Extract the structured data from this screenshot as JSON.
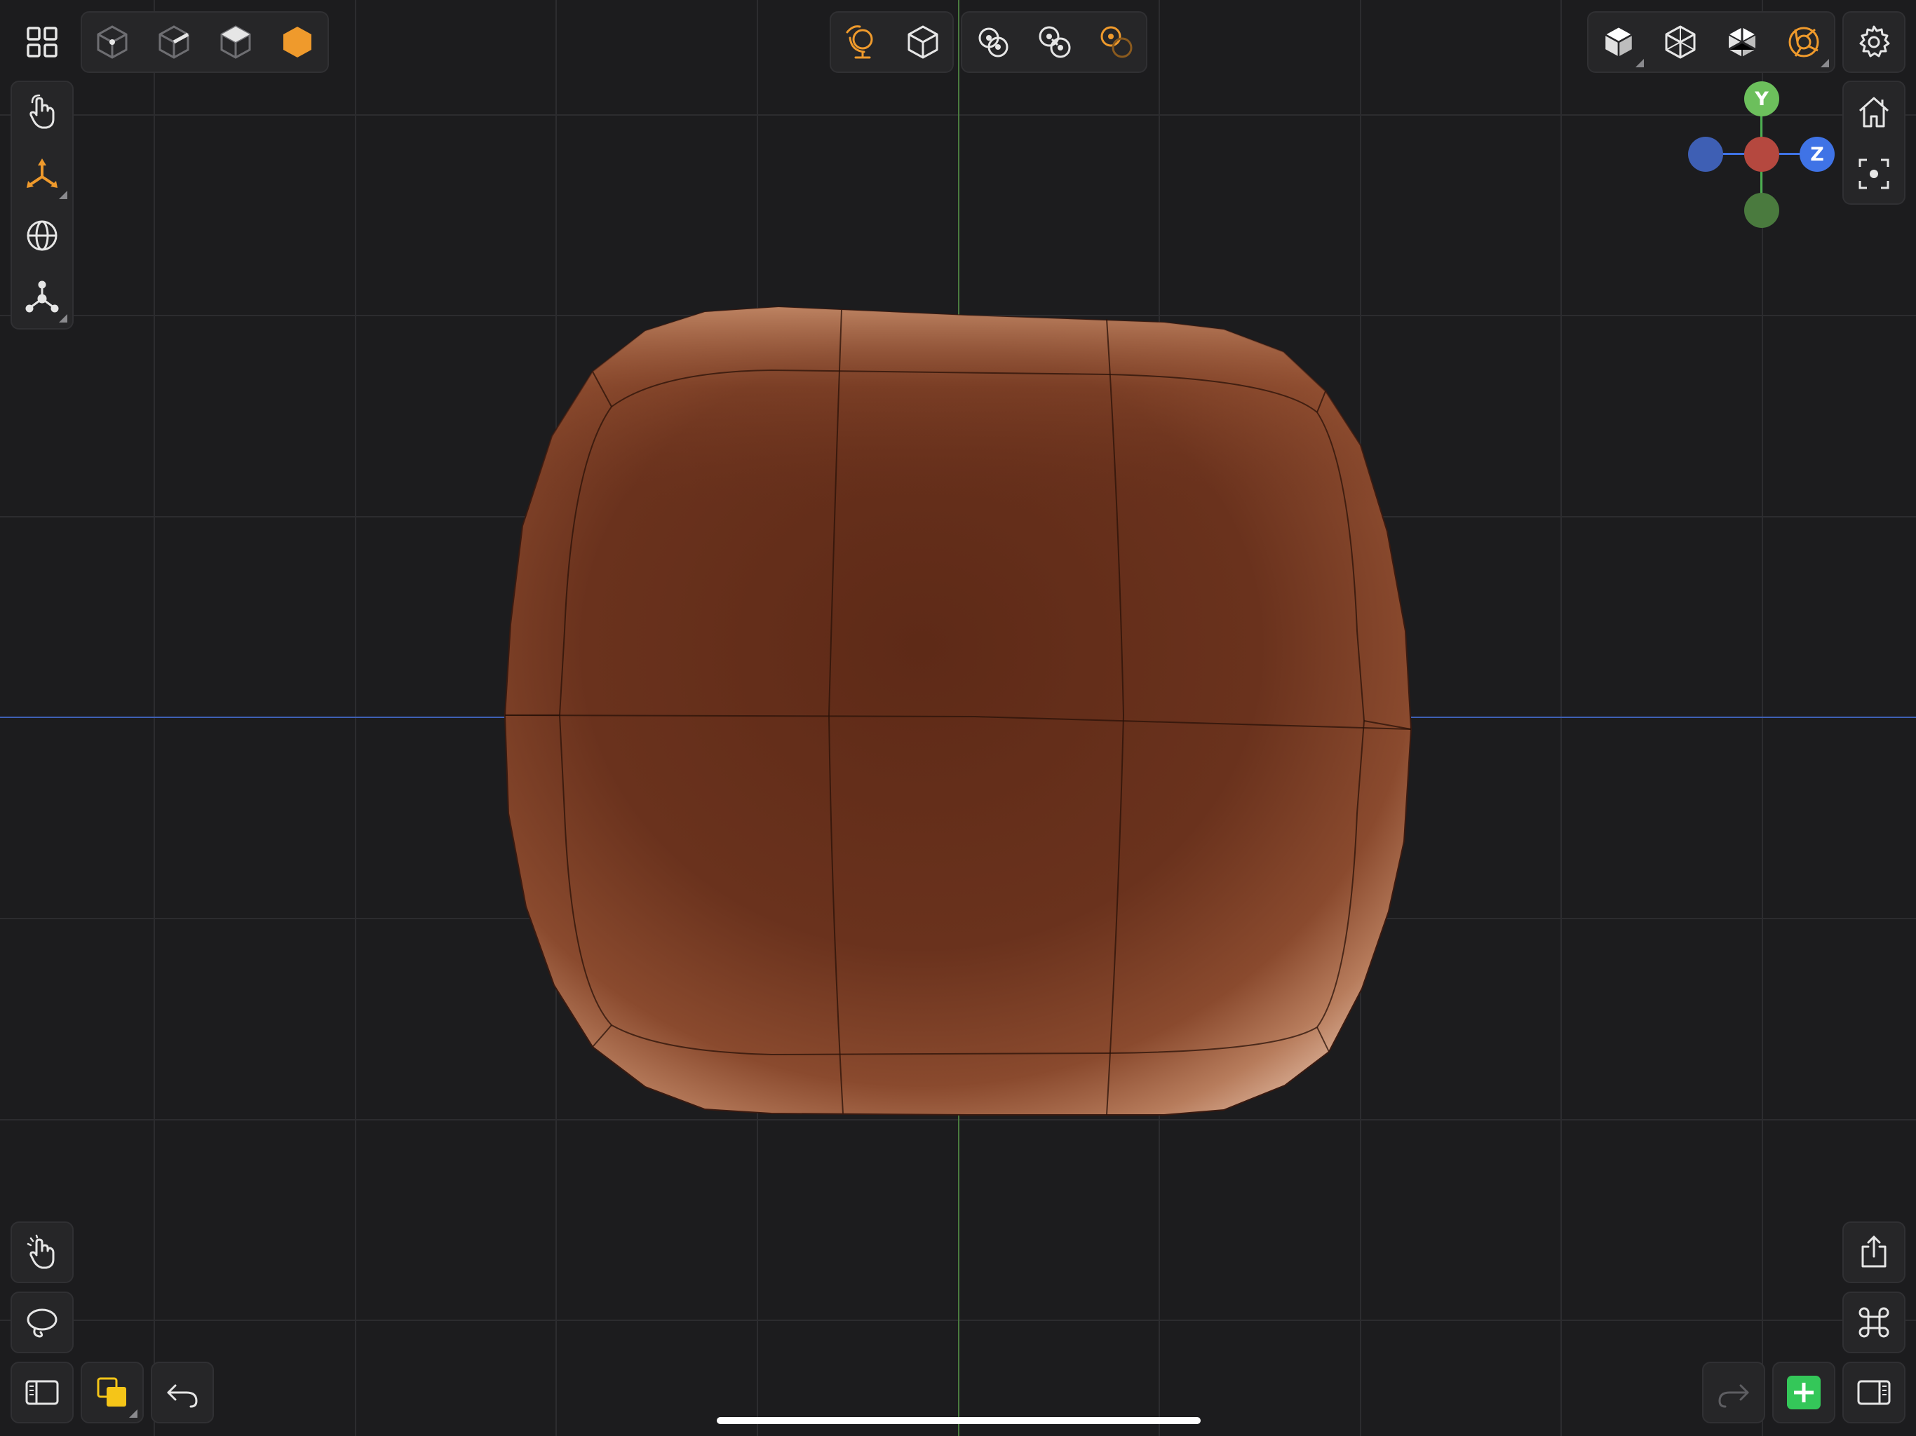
{
  "colors": {
    "background": "#1c1c1e",
    "panel": "#262628",
    "accent": "#ef9a2c",
    "icon": "#e6e6e6",
    "icon_dim": "#8a8a8e",
    "axis_x": "#3e5fb4",
    "axis_y": "#4a7a3e",
    "axis_z": "#3f73e6",
    "model": "#6a301b",
    "add": "#34c759",
    "material_yellow": "#f5c518"
  },
  "top_left_toolbar": {
    "items": [
      {
        "icon": "grid-menu-icon"
      },
      {
        "icon": "vertex-select-icon"
      },
      {
        "icon": "edge-select-icon"
      },
      {
        "icon": "face-select-icon"
      },
      {
        "icon": "object-select-icon",
        "active": true
      }
    ]
  },
  "left_toolbar": {
    "items": [
      {
        "icon": "hand-touch-icon"
      },
      {
        "icon": "move-gizmo-icon",
        "active": true
      },
      {
        "icon": "global-space-icon"
      },
      {
        "icon": "pivot-icon"
      }
    ]
  },
  "top_center_toolbar": {
    "items": [
      {
        "icon": "orbit-globe-icon",
        "active": true
      },
      {
        "icon": "cube-view-icon"
      },
      {
        "icon": "snap-circles-icon"
      },
      {
        "icon": "snap-link-icon"
      },
      {
        "icon": "snap-target-icon",
        "active": true
      }
    ]
  },
  "top_right_toolbar": {
    "items": [
      {
        "icon": "solid-shading-icon"
      },
      {
        "icon": "wireframe-shading-icon"
      },
      {
        "icon": "xray-shading-icon"
      },
      {
        "icon": "render-shading-icon",
        "active": true
      },
      {
        "icon": "settings-gear-icon"
      }
    ]
  },
  "gizmo": {
    "y_label": "Y",
    "z_label": "Z"
  },
  "right_toolbar": {
    "items": [
      {
        "icon": "home-view-icon"
      },
      {
        "icon": "focus-frame-icon"
      }
    ]
  },
  "bottom_left_toolbar": {
    "items": [
      {
        "icon": "tap-gesture-icon"
      },
      {
        "icon": "lasso-icon"
      },
      {
        "icon": "left-sidebar-icon"
      },
      {
        "icon": "material-swatch-icon"
      },
      {
        "icon": "undo-icon"
      }
    ]
  },
  "bottom_right_toolbar": {
    "items": [
      {
        "icon": "share-icon"
      },
      {
        "icon": "command-icon"
      },
      {
        "icon": "redo-icon",
        "disabled": true
      },
      {
        "icon": "add-object-icon"
      },
      {
        "icon": "right-sidebar-icon"
      }
    ]
  }
}
